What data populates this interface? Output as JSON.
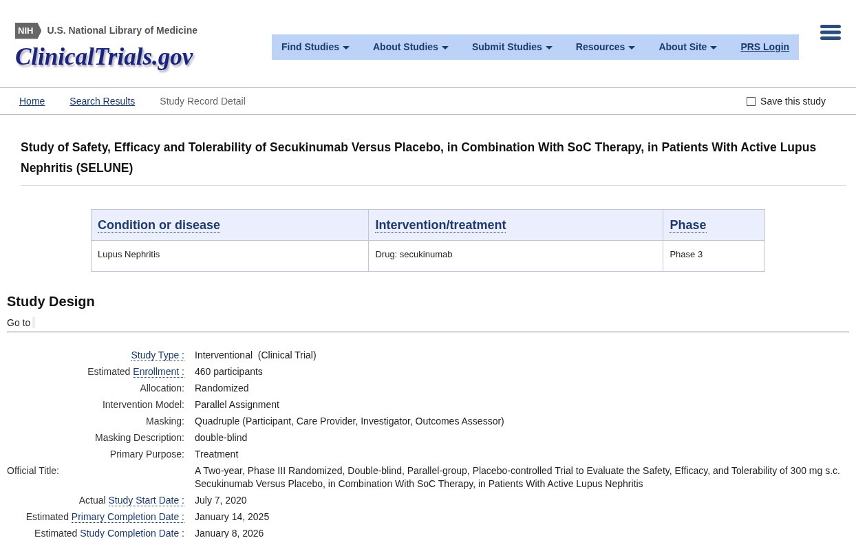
{
  "header": {
    "agency": "U.S. National Library of Medicine",
    "agency_badge": "NIH",
    "site_title": "ClinicalTrials.gov"
  },
  "nav": [
    {
      "label": "Find Studies",
      "dropdown": true
    },
    {
      "label": "About Studies",
      "dropdown": true
    },
    {
      "label": "Submit Studies",
      "dropdown": true
    },
    {
      "label": "Resources",
      "dropdown": true
    },
    {
      "label": "About Site",
      "dropdown": true
    },
    {
      "label": "PRS Login",
      "dropdown": false
    }
  ],
  "breadcrumbs": [
    {
      "label": "Home",
      "link": true
    },
    {
      "label": "Search Results",
      "link": true
    },
    {
      "label": "Study Record Detail",
      "link": false
    }
  ],
  "save_study": {
    "label": "Save this study",
    "checked": false
  },
  "study_title": "Study of Safety, Efficacy and Tolerability of Secukinumab Versus Placebo, in Combination With SoC Therapy, in Patients With Active Lupus Nephritis (SELUNE)",
  "summary_table": {
    "columns": [
      "Condition or disease",
      "Intervention/treatment",
      "Phase"
    ],
    "rows": [
      [
        "Lupus Nephritis",
        "Drug: secukinumab",
        "Phase 3"
      ]
    ]
  },
  "study_design": {
    "heading": "Study Design",
    "goto": "Go to",
    "rows": [
      {
        "kind": "linked",
        "prefix": "",
        "term": "Study Type :",
        "value": "Interventional  (Clinical Trial)"
      },
      {
        "kind": "linked",
        "prefix": "Estimated",
        "term": "Enrollment :",
        "value": "460 participants"
      },
      {
        "kind": "plain",
        "label": "Allocation:",
        "value": "Randomized"
      },
      {
        "kind": "plain",
        "label": "Intervention Model:",
        "value": "Parallel Assignment"
      },
      {
        "kind": "plain",
        "label": "Masking:",
        "value": "Quadruple (Participant, Care Provider, Investigator, Outcomes Assessor)"
      },
      {
        "kind": "plain",
        "label": "Masking Description:",
        "value": "double-blind"
      },
      {
        "kind": "plain",
        "label": "Primary Purpose:",
        "value": "Treatment"
      },
      {
        "kind": "wide",
        "label": "Official Title:",
        "value": "A Two-year, Phase III Randomized, Double-blind, Parallel-group, Placebo-controlled Trial to Evaluate the Safety, Efficacy, and Tolerability of 300 mg s.c. Secukinumab Versus Placebo, in Combination With SoC Therapy, in Patients With Active Lupus Nephritis"
      },
      {
        "kind": "linked",
        "prefix": "Actual",
        "term": "Study Start Date :",
        "value": "July 7, 2020"
      },
      {
        "kind": "linked",
        "prefix": "Estimated",
        "term": "Primary Completion Date :",
        "value": "January 14, 2025"
      },
      {
        "kind": "linked",
        "prefix": "Estimated",
        "term": "Study Completion Date :",
        "value": "January 8, 2026"
      }
    ]
  }
}
